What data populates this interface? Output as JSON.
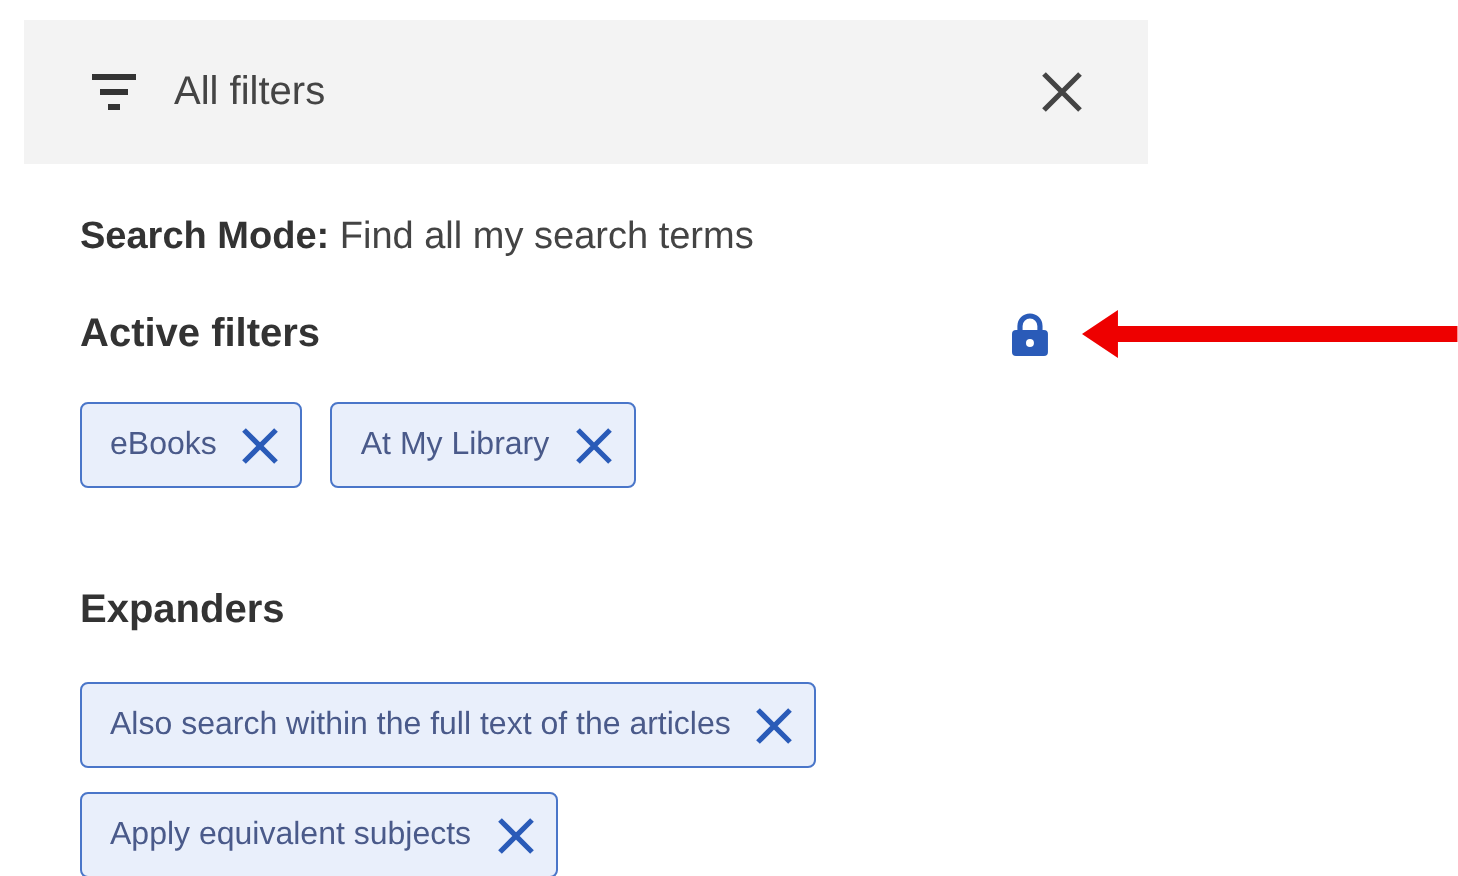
{
  "header": {
    "title": "All filters"
  },
  "search_mode": {
    "label": "Search Mode:",
    "value": "Find all my search terms"
  },
  "active_filters": {
    "title": "Active filters",
    "locked": true,
    "chips": [
      {
        "label": "eBooks"
      },
      {
        "label": "At My Library"
      }
    ]
  },
  "expanders": {
    "title": "Expanders",
    "chips": [
      {
        "label": "Also search within the full text of the articles"
      },
      {
        "label": "Apply equivalent subjects"
      }
    ]
  }
}
